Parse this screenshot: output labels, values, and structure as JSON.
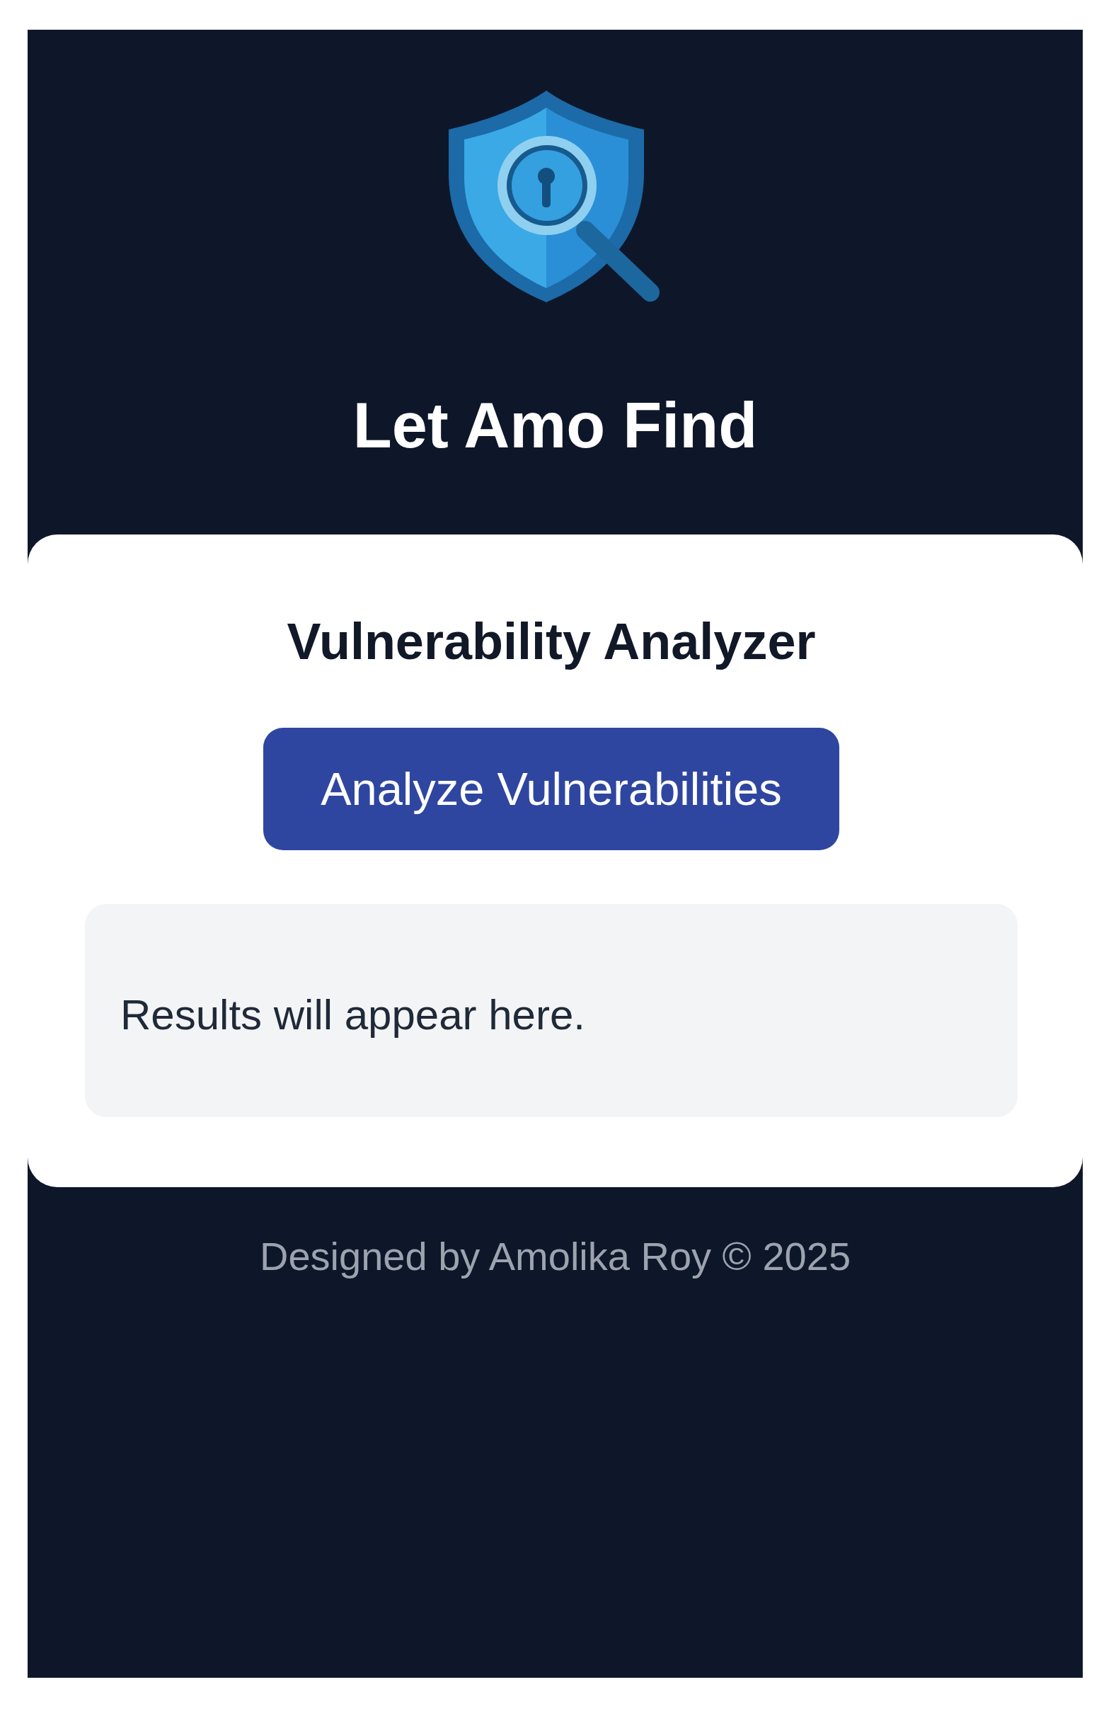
{
  "header": {
    "title": "Let Amo Find"
  },
  "analyzer": {
    "title": "Vulnerability Analyzer",
    "button": "Analyze Vulnerabilities",
    "results": {
      "text": "Results will appear here."
    }
  },
  "footer": {
    "text": "Designed by Amolika Roy © 2025"
  }
}
